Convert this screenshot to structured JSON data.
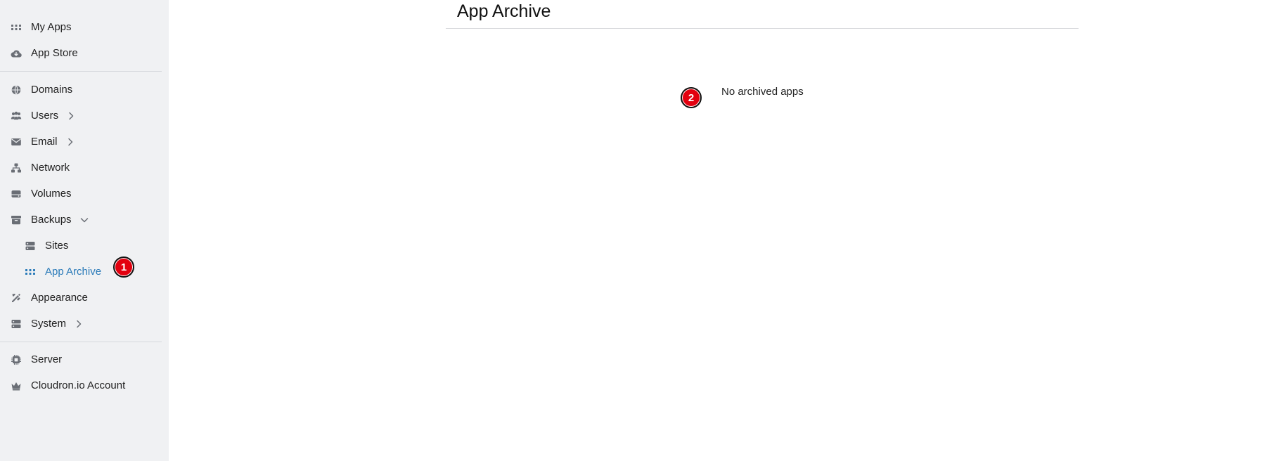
{
  "sidebar": {
    "items": [
      {
        "label": "My Apps",
        "icon": "grid-icon"
      },
      {
        "label": "App Store",
        "icon": "cloud-download-icon"
      },
      {
        "label": "Domains",
        "icon": "globe-icon"
      },
      {
        "label": "Users",
        "icon": "users-icon"
      },
      {
        "label": "Email",
        "icon": "envelope-icon"
      },
      {
        "label": "Network",
        "icon": "network-icon"
      },
      {
        "label": "Volumes",
        "icon": "drive-icon"
      },
      {
        "label": "Backups",
        "icon": "archive-icon"
      },
      {
        "label": "Sites",
        "icon": "server-icon"
      },
      {
        "label": "App Archive",
        "icon": "grid-icon"
      },
      {
        "label": "Appearance",
        "icon": "paint-tools-icon"
      },
      {
        "label": "System",
        "icon": "server-icon"
      },
      {
        "label": "Server",
        "icon": "chip-icon"
      },
      {
        "label": "Cloudron.io Account",
        "icon": "crown-icon"
      }
    ]
  },
  "main": {
    "title": "App Archive",
    "empty_message": "No archived apps"
  },
  "markers": [
    "1",
    "2"
  ],
  "colors": {
    "sidebar_bg": "#f0f1f3",
    "active": "#2b7bb9",
    "marker": "#e3000f"
  }
}
